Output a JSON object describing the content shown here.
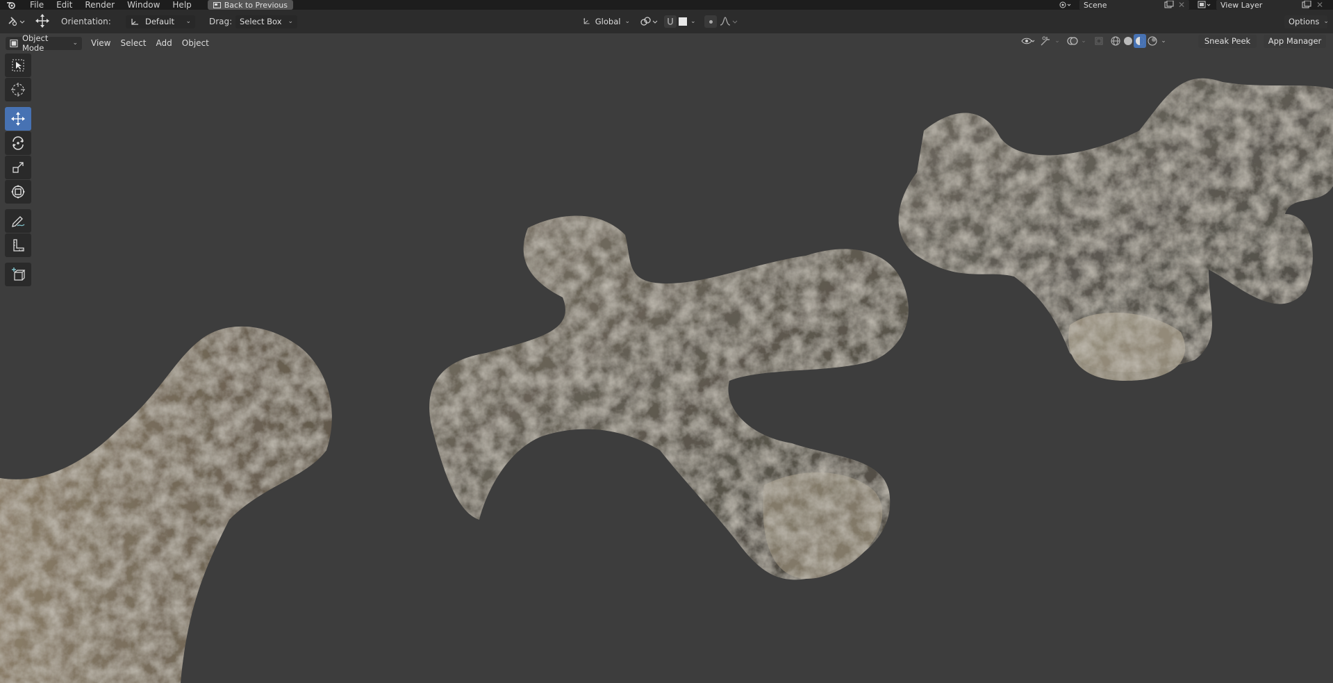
{
  "topbar": {
    "menu": [
      "File",
      "Edit",
      "Render",
      "Window",
      "Help"
    ],
    "back_label": "Back to Previous",
    "scene_name": "Scene",
    "view_layer": "View Layer"
  },
  "tool_header": {
    "orientation_label": "Orientation:",
    "orientation_value": "Default",
    "drag_label": "Drag:",
    "drag_value": "Select Box",
    "transform_orientation": "Global",
    "options_label": "Options"
  },
  "view_header": {
    "mode": "Object Mode",
    "menu": [
      "View",
      "Select",
      "Add",
      "Object"
    ],
    "sneak_peek": "Sneak Peek",
    "app_manager": "App Manager"
  },
  "toolbar": {
    "tools": [
      "select-box-icon",
      "cursor-icon",
      "move-icon",
      "rotate-icon",
      "scale-icon",
      "transform-icon",
      "annotate-icon",
      "measure-icon",
      "add-cube-icon"
    ],
    "active": "move-icon"
  },
  "colors": {
    "accent": "#4772b3",
    "background": "#3d3d3d",
    "header": "#2c2c2c",
    "topbar": "#1d1d1d"
  }
}
